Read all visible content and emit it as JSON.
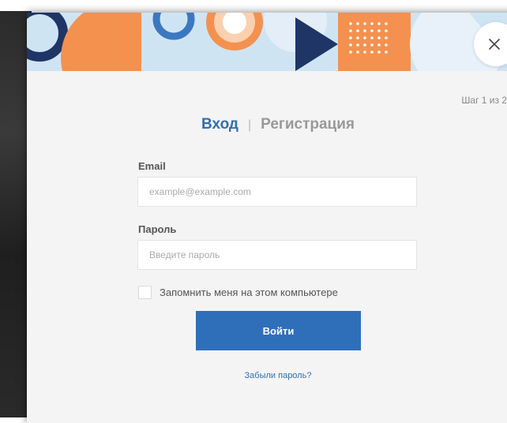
{
  "step_indicator": "Шаг 1 из 2",
  "tabs": {
    "login": "Вход",
    "separator": "|",
    "register": "Регистрация",
    "active": "login"
  },
  "form": {
    "email": {
      "label": "Email",
      "placeholder": "example@example.com",
      "value": ""
    },
    "password": {
      "label": "Пароль",
      "placeholder": "Введите пароль",
      "value": ""
    },
    "remember": {
      "label": "Запомнить меня на этом компьютере",
      "checked": false
    },
    "submit_label": "Войти",
    "forgot_label": "Забыли пароль?"
  },
  "icons": {
    "close": "close-icon"
  },
  "colors": {
    "accent": "#2f6fb9",
    "banner_bg": "#cfe4f3",
    "navy": "#1f3566",
    "orange": "#f4914f",
    "blue": "#3c78c0",
    "modal_bg": "#f4f4f4"
  }
}
